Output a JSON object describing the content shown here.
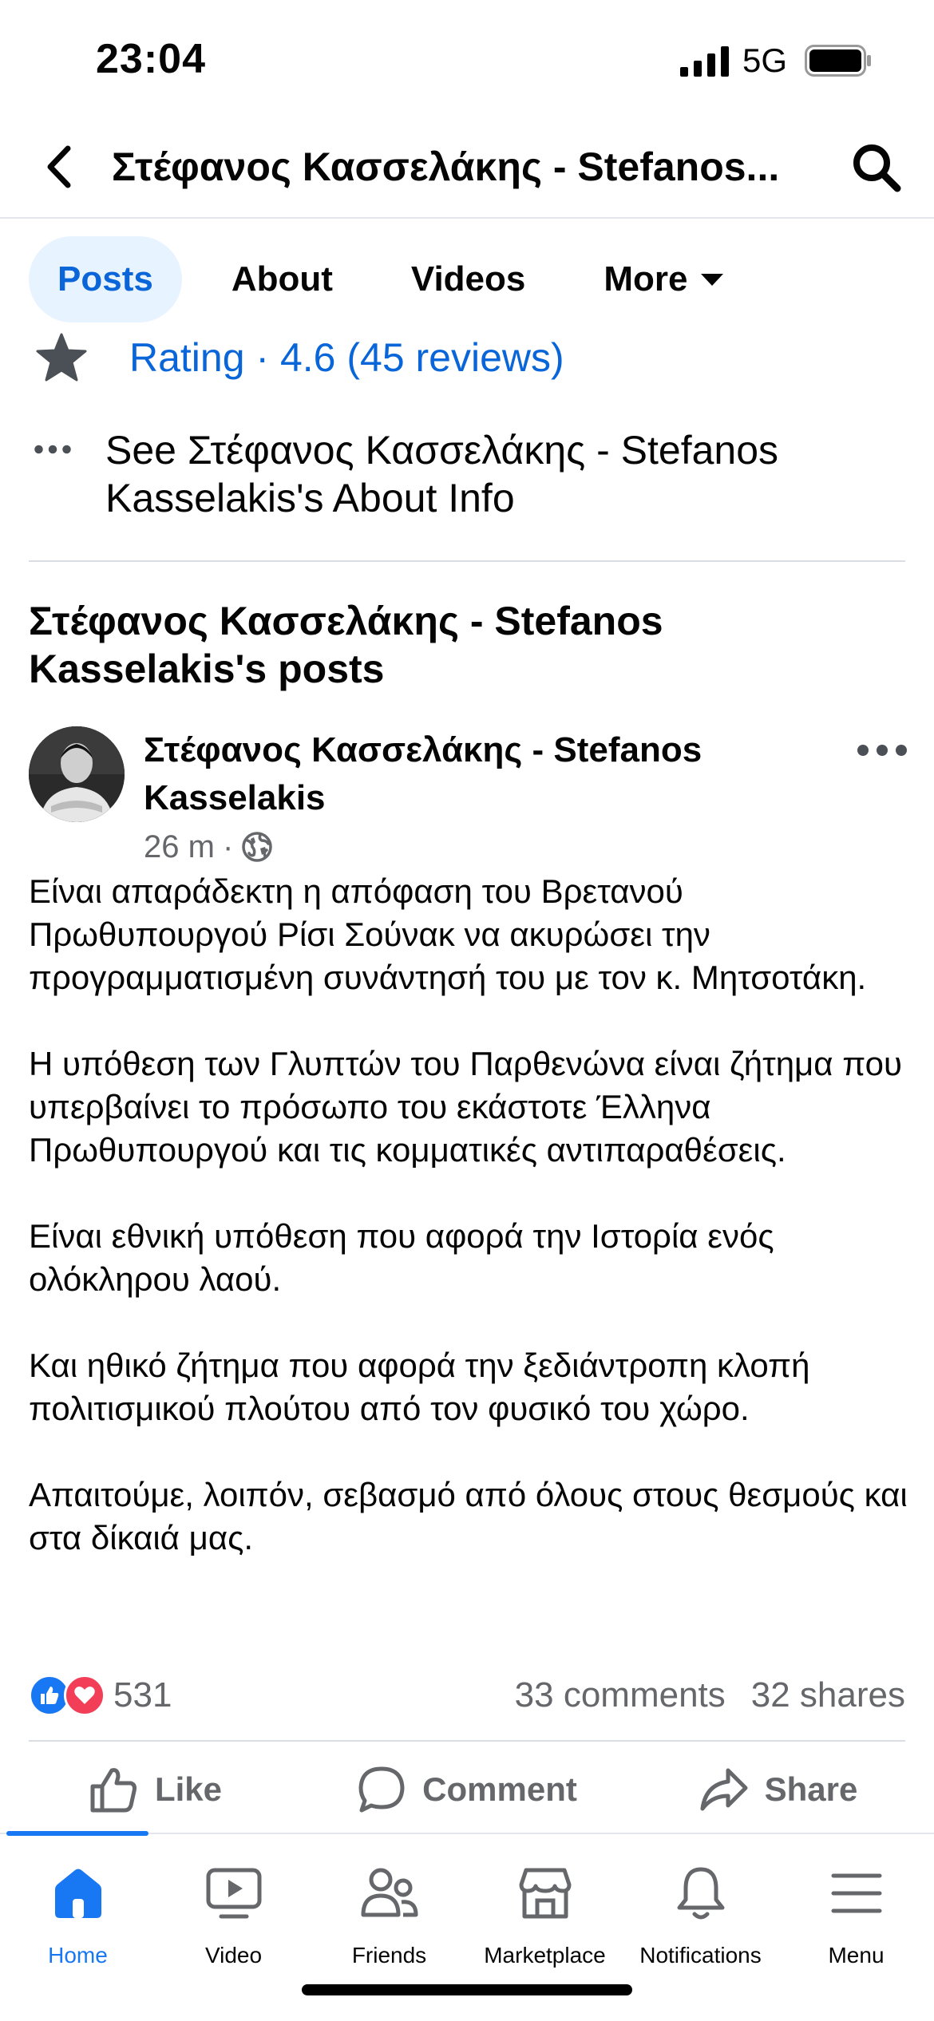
{
  "status_bar": {
    "time": "23:04",
    "network": "5G"
  },
  "header": {
    "title": "Στέφανος Κασσελάκης - Stefanos..."
  },
  "tabs": [
    {
      "label": "Posts",
      "active": true
    },
    {
      "label": "About",
      "active": false
    },
    {
      "label": "Videos",
      "active": false
    },
    {
      "label": "More",
      "active": false
    }
  ],
  "rating": {
    "text": "Rating · 4.6 (45 reviews)",
    "icon": "star-icon"
  },
  "about_link": {
    "text": "See Στέφανος Κασσελάκης - Stefanos Kasselakis's About Info"
  },
  "posts_heading": "Στέφανος Κασσελάκης - Stefanos Kasselakis's posts",
  "post": {
    "author": "Στέφανος Κασσελάκης - Stefanos Kasselakis",
    "time": "26 m",
    "audience_icon": "globe-icon",
    "paragraphs": [
      "Είναι απαράδεκτη η απόφαση του Βρετανού Πρωθυπουργού Ρίσι Σούνακ να ακυρώσει την προγραμματισμένη συνάντησή του με τον κ. Μητσοτάκη.",
      "Η υπόθεση των Γλυπτών του Παρθενώνα είναι ζήτημα που υπερβαίνει το πρόσωπο του εκάστοτε Έλληνα Πρωθυπουργού και τις κομματικές αντιπαραθέσεις.",
      "Είναι εθνική υπόθεση που αφορά την Ιστορία ενός ολόκληρου λαού.",
      "Και ηθικό ζήτημα που αφορά την ξεδιάντροπη κλοπή πολιτισμικού πλούτου από τον φυσικό του χώρο.",
      "Απαιτούμε, λοιπόν, σεβασμό από όλους στους θεσμούς και στα δίκαιά μας."
    ],
    "reactions_count": "531",
    "comments": "33 comments",
    "shares": "32 shares",
    "actions": {
      "like": "Like",
      "comment": "Comment",
      "share": "Share"
    }
  },
  "tabbar": [
    {
      "label": "Home",
      "icon": "home-icon",
      "active": true
    },
    {
      "label": "Video",
      "icon": "video-icon",
      "active": false
    },
    {
      "label": "Friends",
      "icon": "friends-icon",
      "active": false
    },
    {
      "label": "Marketplace",
      "icon": "marketplace-icon",
      "active": false
    },
    {
      "label": "Notifications",
      "icon": "bell-icon",
      "active": false
    },
    {
      "label": "Menu",
      "icon": "menu-icon",
      "active": false
    }
  ],
  "colors": {
    "accent": "#1877f2",
    "link": "#0a66d8",
    "muted": "#65676b",
    "tab_active_bg": "#e7f3ff"
  }
}
